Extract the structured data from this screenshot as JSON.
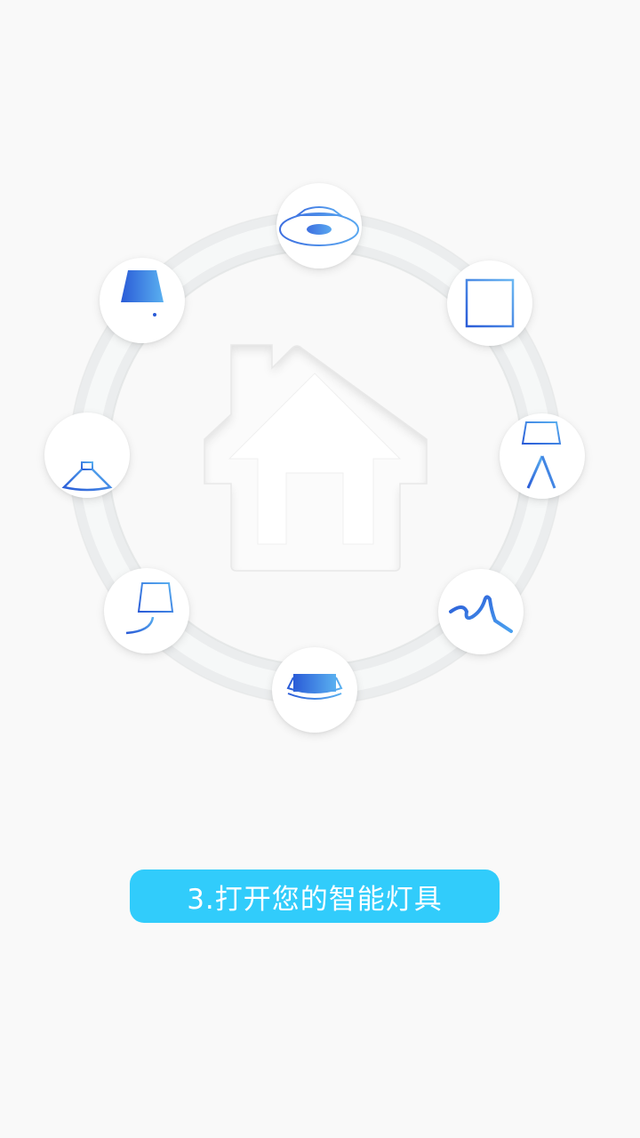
{
  "step": {
    "label": "3.打开您的智能灯具"
  },
  "center": {
    "icon": "house-icon"
  },
  "lamps": [
    {
      "name": "ceiling-light-icon"
    },
    {
      "name": "panel-light-icon"
    },
    {
      "name": "floor-lamp-icon"
    },
    {
      "name": "light-strip-icon"
    },
    {
      "name": "downlight-icon"
    },
    {
      "name": "wall-lamp-icon"
    },
    {
      "name": "pendant-lamp-icon"
    },
    {
      "name": "table-lamp-icon"
    }
  ],
  "colors": {
    "background": "#f9f9f9",
    "accent": "#31ccfb",
    "icon_dark": "#2a5bd7",
    "icon_light": "#5ab0f0"
  }
}
